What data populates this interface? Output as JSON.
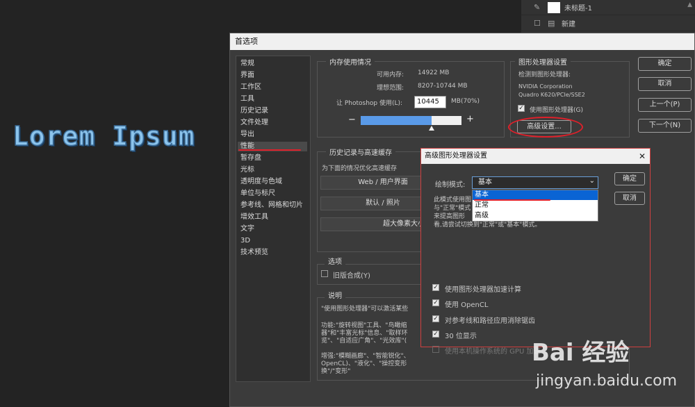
{
  "canvas": {
    "text": "Lorem Ipsum"
  },
  "layers": [
    {
      "name": "未标题-1"
    },
    {
      "name": "新建"
    }
  ],
  "prefs": {
    "title": "首选项",
    "nav": [
      "常规",
      "界面",
      "工作区",
      "工具",
      "历史记录",
      "文件处理",
      "导出",
      "性能",
      "暂存盘",
      "光标",
      "透明度与色域",
      "单位与标尺",
      "参考线、网格和切片",
      "增效工具",
      "文字",
      "3D",
      "技术预览"
    ],
    "selected_nav": "性能",
    "memory": {
      "label": "内存使用情况",
      "available_label": "可用内存:",
      "available_value": "14922 MB",
      "ideal_label": "理想范围:",
      "ideal_value": "8207-10744 MB",
      "use_label": "让 Photoshop 使用(L):",
      "use_value": "10445",
      "use_unit": "MB(70%)",
      "slider_fraction": 0.7,
      "minus": "−",
      "plus": "+"
    },
    "gpu": {
      "label": "图形处理器设置",
      "detected_label": "检测到图形处理器:",
      "vendor": "NVIDIA Corporation",
      "model": "Quadro K620/PCIe/SSE2",
      "use_gpu_label": "使用图形处理器(G)",
      "advanced_button": "高级设置..."
    },
    "history": {
      "label": "历史记录与高速缓存",
      "desc": "为下面的情况优化高速缓存",
      "btn_web": "Web / 用户界面",
      "btn_default": "默认 / 照片",
      "btn_large": "超大像素大小"
    },
    "options": {
      "label": "选项",
      "legacy_label": "旧版合成(Y)"
    },
    "description": {
      "label": "说明",
      "p1": "\"使用图形处理器\"可以激活某些",
      "p2a": "功能:\"旋转视图\"工具、\"鸟瞰缩",
      "p2b": "器\"和\"丰富光标\"信息、\"取样环",
      "p2c": "览\"、\"自适应广角\"、\"光效库\"(",
      "p3a": "增强:\"模糊画廊\"、\"智能锐化\"、",
      "p3b": "OpenCL)、\"液化\"、\"操控变形",
      "p3c": "换\"/\"变形\""
    },
    "buttons": {
      "ok": "确定",
      "cancel": "取消",
      "prev": "上一个(P)",
      "next": "下一个(N)"
    }
  },
  "advanced": {
    "title": "高级图形处理器设置",
    "close": "✕",
    "mode_label": "绘制模式:",
    "mode_value": "基本",
    "chevron": "⌄",
    "options": [
      "基本",
      "正常",
      "高级"
    ],
    "hint1": "此模式使用图",
    "hint2": "与\"正常\"模式",
    "hint3": "来提高图形",
    "hint4": "看,请尝试切换到\"正常\"或\"基本\"模式。",
    "ok": "确定",
    "cancel": "取消",
    "checks": [
      {
        "label": "使用图形处理器加速计算",
        "checked": true
      },
      {
        "label": "使用 OpenCL",
        "checked": true
      },
      {
        "label": "对参考线和路径应用消除锯齿",
        "checked": true
      },
      {
        "label": "30 位显示",
        "checked": true
      },
      {
        "label": "使用本机操作系统的 GPU 加速",
        "checked": false
      }
    ]
  },
  "watermark": {
    "logo": "Bai 经验",
    "url": "jingyan.baidu.com"
  },
  "colors": {
    "accent": "#0a64d4",
    "annotation": "#e0202a",
    "slider": "#5a9ae8"
  }
}
